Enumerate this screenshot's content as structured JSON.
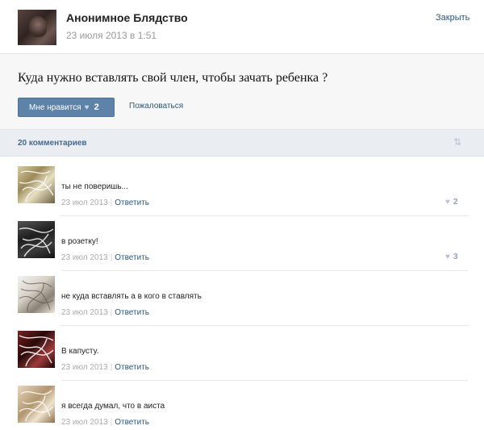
{
  "post": {
    "author": "Анонимное Блядство",
    "date": "23 июля 2013 в 1:51",
    "close_label": "Закрыть",
    "text": "Куда нужно вставлять свой член, чтобы зачать ребенка ?",
    "like_label": "Мне нравится",
    "like_count": "2",
    "report_label": "Пожаловаться"
  },
  "comments_header": {
    "count_label": "20 комментариев",
    "sort_icon": "sort-arrows-icon"
  },
  "comments": [
    {
      "text": "ты не поверишь...",
      "date": "23 июл 2013",
      "reply_label": "Ответить",
      "likes": "2"
    },
    {
      "text": "в розетку!",
      "date": "23 июл 2013",
      "reply_label": "Ответить",
      "likes": "3"
    },
    {
      "text": "не куда вставлять а в кого в ставлять",
      "date": "23 июл 2013",
      "reply_label": "Ответить",
      "likes": ""
    },
    {
      "text": "В капусту.",
      "date": "23 июл 2013",
      "reply_label": "Ответить",
      "likes": ""
    },
    {
      "text": "я всегда думал, что в аиста",
      "date": "23 июл 2013",
      "reply_label": "Ответить",
      "likes": ""
    }
  ],
  "colors": {
    "link": "#2b587a",
    "button": "#5e82a8",
    "header_bar": "#eaeef2"
  }
}
